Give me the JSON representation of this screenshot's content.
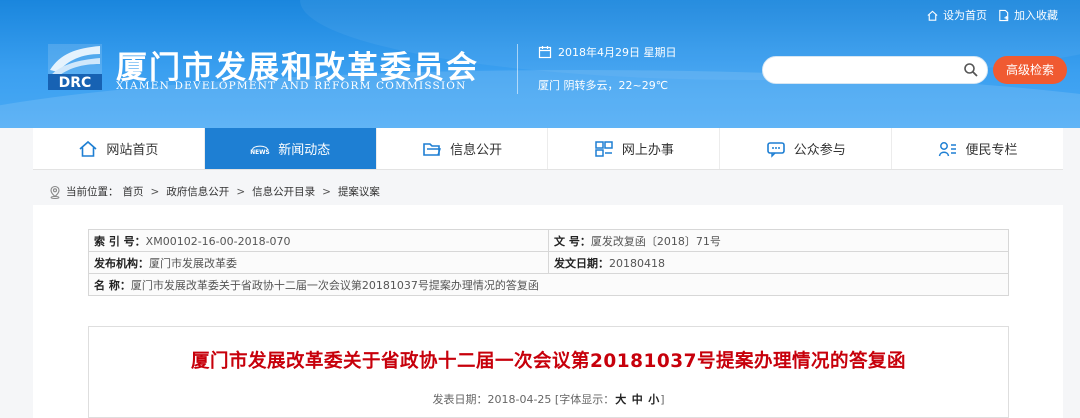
{
  "colors": {
    "header_blue": "#2b93e8",
    "nav_active": "#1e7fd3",
    "search_button": "#f05a31",
    "title_red": "#c7000b"
  },
  "toplinks": {
    "home": "设为首页",
    "favorite": "加入收藏"
  },
  "site": {
    "logo_text": "DRC",
    "title": "厦门市发展和改革委员会",
    "subtitle": "XIAMEN DEVELOPMENT AND REFORM COMMISSION",
    "date": "2018年4月29日 星期日",
    "weather": "厦门 阴转多云，22~29℃"
  },
  "search": {
    "value": "",
    "placeholder": "",
    "button": "高级检索"
  },
  "nav": {
    "home": "网站首页",
    "news": "新闻动态",
    "info": "信息公开",
    "online": "网上办事",
    "public": "公众参与",
    "service": "便民专栏"
  },
  "breadcrumb": {
    "label": "当前位置：",
    "items": [
      "首页",
      "政府信息公开",
      "信息公开目录",
      "提案议案"
    ],
    "sep": ">"
  },
  "meta": {
    "index_label": "索 引 号：",
    "index_value": "XM00102-16-00-2018-070",
    "docno_label": "文 号：",
    "docno_value": "厦发改复函〔2018〕71号",
    "org_label": "发布机构：",
    "org_value": "厦门市发展改革委",
    "date_label": "发文日期：",
    "date_value": "20180418",
    "name_label": "名 称：",
    "name_value": "厦门市发展改革委关于省政协十二届一次会议第20181037号提案办理情况的答复函"
  },
  "article": {
    "title": "厦门市发展改革委关于省政协十二届一次会议第20181037号提案办理情况的答复函",
    "publish_label": "发表日期：",
    "publish_date": "2018-04-25",
    "font_prefix": "[字体显示：",
    "size_large": "大",
    "size_medium": "中",
    "size_small": "小",
    "font_suffix": "]"
  }
}
